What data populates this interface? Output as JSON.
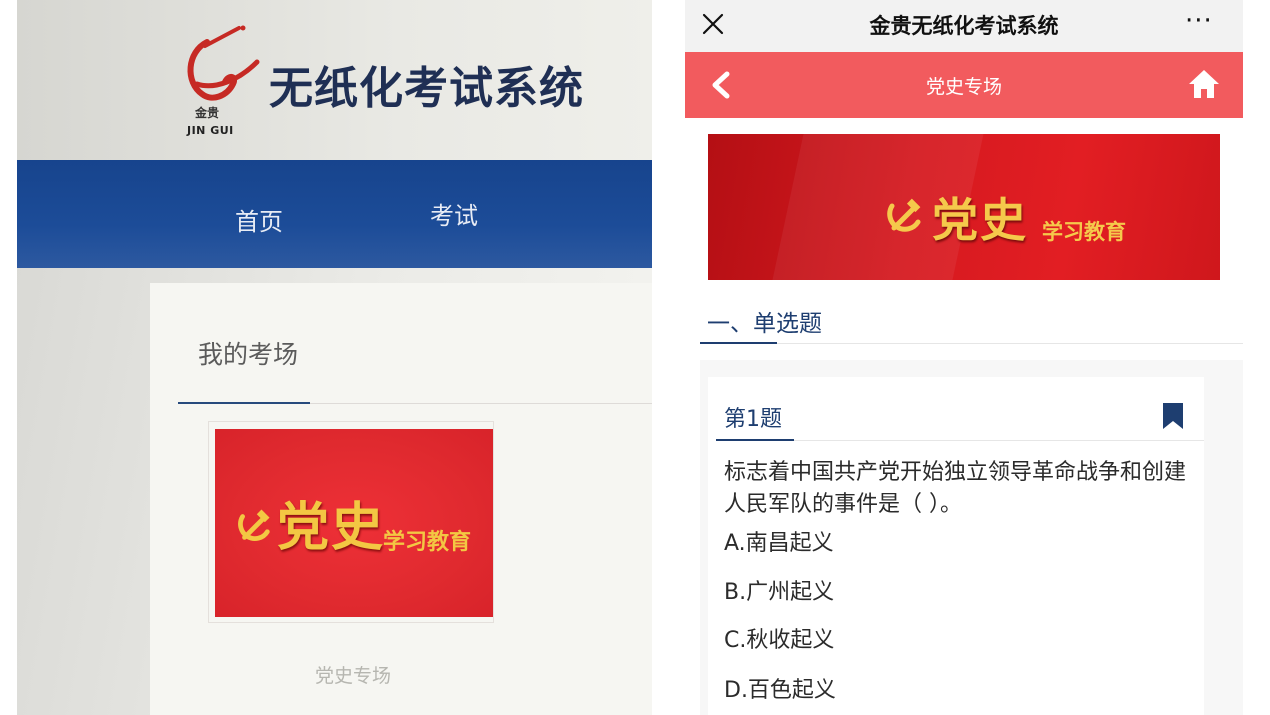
{
  "left_screen": {
    "logo": {
      "cn": "金贵",
      "en": "JIN GUI"
    },
    "site_title": "无纸化考试系统",
    "nav": {
      "home": "首页",
      "exam": "考试"
    },
    "card_title": "我的考场",
    "banner": {
      "big": "党史",
      "small": "学习教育"
    },
    "banner_caption": "党史专场"
  },
  "app": {
    "titlebar": {
      "title": "金贵无纸化考试系统",
      "more": "···"
    },
    "header": {
      "title": "党史专场"
    },
    "banner": {
      "big": "党史",
      "small": "学习教育"
    },
    "section_title": "一、单选题",
    "question": {
      "number": "第1题",
      "text": "标志着中国共产党开始独立领导革命战争和创建人民军队的事件是（ ）。",
      "options": [
        "A.南昌起义",
        "B.广州起义",
        "C.秋收起义",
        "D.百色起义"
      ]
    }
  },
  "icons": [
    "logo-swoosh-icon",
    "hammer-sickle-icon",
    "close-icon",
    "more-icon",
    "back-icon",
    "home-icon",
    "bookmark-icon"
  ],
  "colors": {
    "nav_blue": "#1c4c98",
    "header_red": "#f25b5e",
    "banner_red": "#e21e23",
    "gold": "#f5c94b",
    "accent_navy": "#1e3e70"
  }
}
